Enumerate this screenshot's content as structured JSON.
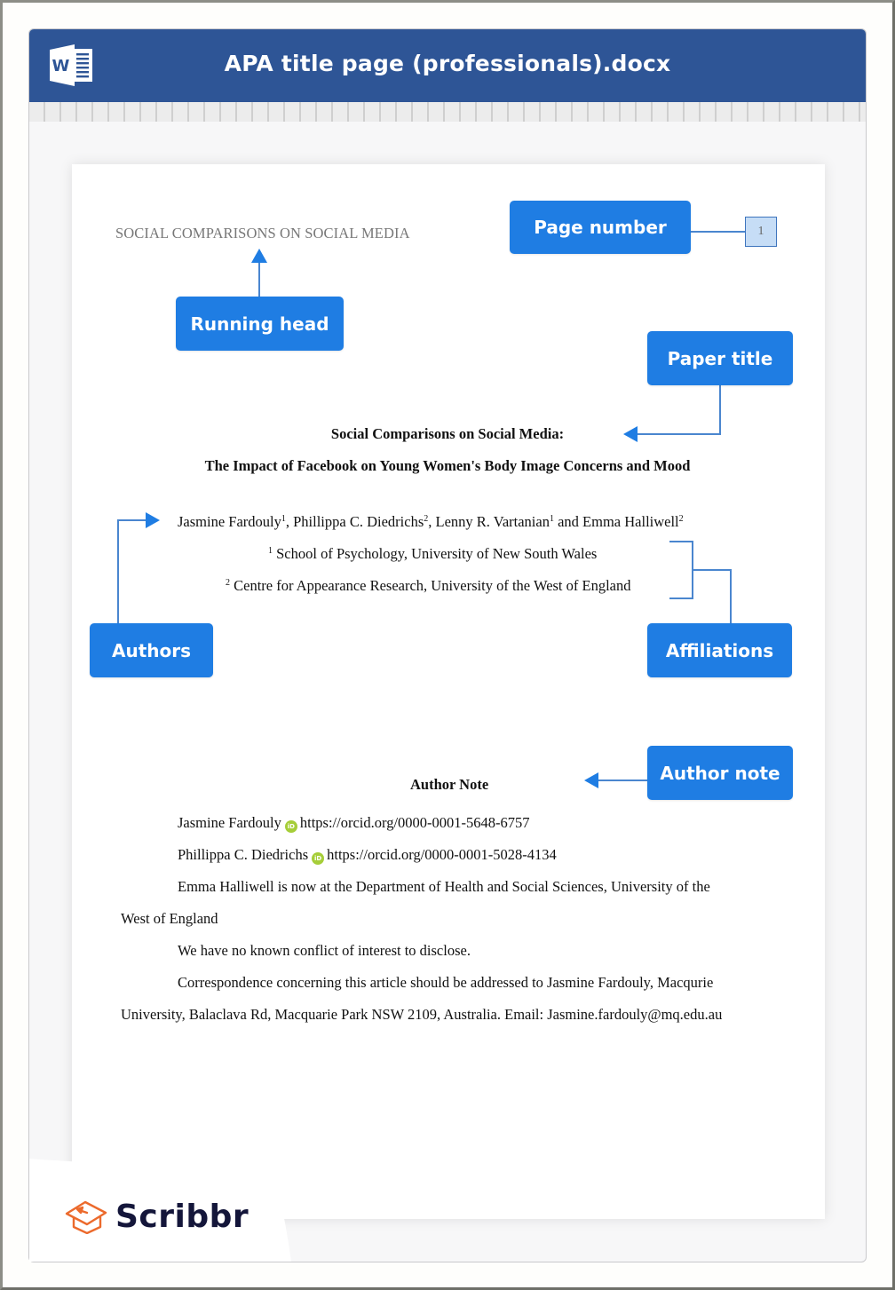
{
  "window": {
    "title": "APA title page (professionals).docx",
    "app_icon": "word-icon"
  },
  "document": {
    "running_head": "SOCIAL COMPARISONS ON SOCIAL MEDIA",
    "page_number": "1",
    "title_line_1": "Social Comparisons on Social Media:",
    "title_line_2": "The Impact of Facebook on Young Women's Body Image Concerns and Mood",
    "authors": [
      {
        "name": "Jasmine Fardouly",
        "affiliation": "1",
        "sep": ", "
      },
      {
        "name": "Phillippa C. Diedrichs",
        "affiliation": "2",
        "sep": ", "
      },
      {
        "name": "Lenny R. Vartanian",
        "affiliation": "1",
        "sep": " and "
      },
      {
        "name": "Emma Halliwell",
        "affiliation": "2",
        "sep": ""
      }
    ],
    "affiliations": [
      {
        "num": "1",
        "text": " School of Psychology, University of New South Wales"
      },
      {
        "num": "2",
        "text": " Centre for Appearance Research, University of the West of England"
      }
    ],
    "author_note_heading": "Author Note",
    "orcid_entries": [
      {
        "name": "Jasmine Fardouly",
        "icon": "orcid-icon",
        "url": "https://orcid.org/0000-0001-5648-6757"
      },
      {
        "name": "Phillippa C. Diedrichs",
        "icon": "orcid-icon",
        "url": "https://orcid.org/0000-0001-5028-4134"
      }
    ],
    "note_lines": {
      "change_line_1": "Emma Halliwell is now at the Department of Health and Social Sciences, University of the",
      "change_line_2": "West of England",
      "conflict": "We have no known conflict of interest to disclose.",
      "correspondence_line_1": "Correspondence concerning this article should be addressed to Jasmine Fardouly, Macqurie",
      "correspondence_line_2": "University, Balaclava Rd, Macquarie Park NSW 2109, Australia. Email: Jasmine.fardouly@mq.edu.au"
    }
  },
  "callouts": {
    "page_number": "Page number",
    "running_head": "Running head",
    "paper_title": "Paper title",
    "authors": "Authors",
    "affiliations": "Affiliations",
    "author_note": "Author note"
  },
  "brand": {
    "name": "Scribbr",
    "accent_color": "#1f7de3",
    "header_color": "#2e5596",
    "logo_color": "#ec6a2c"
  }
}
